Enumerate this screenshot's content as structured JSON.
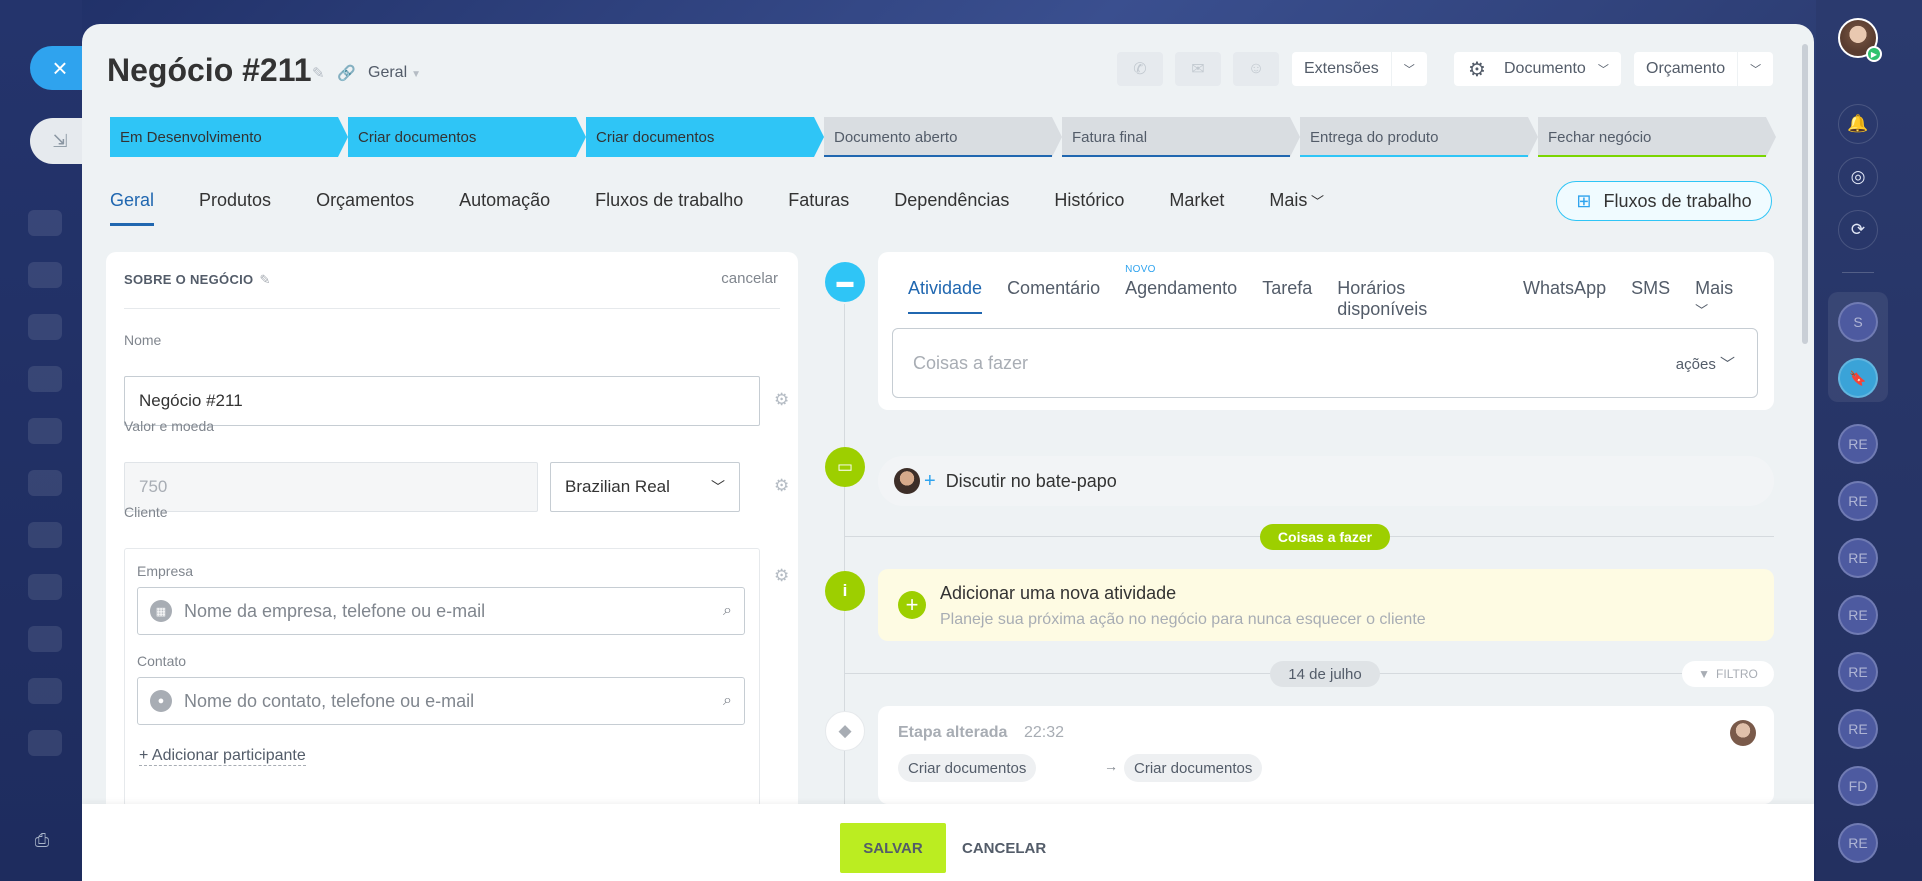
{
  "window": {
    "close_icon": "×",
    "minimize_icon": "⇲"
  },
  "header": {
    "title": "Negócio #211",
    "pipeline": "Geral",
    "extensions": "Extensões",
    "documento": "Documento",
    "orcamento": "Orçamento"
  },
  "stages": [
    {
      "label": "Em Desenvolvimento",
      "state": "done",
      "line": "#2fc5f6"
    },
    {
      "label": "Criar documentos",
      "state": "done",
      "line": "#2fc5f6"
    },
    {
      "label": "Criar documentos",
      "state": "done",
      "line": "#2fc5f6"
    },
    {
      "label": "Documento aberto",
      "state": "todo",
      "line": "#2067b0"
    },
    {
      "label": "Fatura final",
      "state": "todo",
      "line": "#2067b0"
    },
    {
      "label": "Entrega do produto",
      "state": "todo",
      "line": "#2fc5f6"
    },
    {
      "label": "Fechar negócio",
      "state": "todo",
      "line": "#7bd500"
    }
  ],
  "tabs": [
    "Geral",
    "Produtos",
    "Orçamentos",
    "Automação",
    "Fluxos de trabalho",
    "Faturas",
    "Dependências",
    "Histórico",
    "Market",
    "Mais"
  ],
  "workflow_button": "Fluxos de trabalho",
  "about": {
    "title": "SOBRE O NEGÓCIO",
    "cancel": "cancelar",
    "name_label": "Nome",
    "name_value": "Negócio #211",
    "value_label": "Valor e moeda",
    "value": "750",
    "currency": "Brazilian Real",
    "client_label": "Cliente",
    "company_label": "Empresa",
    "company_placeholder": "Nome da empresa, telefone ou e-mail",
    "contact_label": "Contato",
    "contact_placeholder": "Nome do contato, telefone ou e-mail",
    "add_participant": "+ Adicionar participante"
  },
  "activity": {
    "tabs": [
      "Atividade",
      "Comentário",
      "Agendamento",
      "Tarefa",
      "Horários disponíveis",
      "WhatsApp",
      "SMS",
      "Mais"
    ],
    "new_badge": "NOVO",
    "todo_placeholder": "Coisas a fazer",
    "acoes": "ações",
    "chat": "Discutir no bate-papo",
    "todo_badge": "Coisas a fazer",
    "new_title": "Adicionar uma nova atividade",
    "new_sub": "Planeje sua próxima ação no negócio para nunca esquecer o cliente",
    "date": "14 de julho",
    "filter": "FILTRO",
    "stage_changed": "Etapa alterada",
    "stage_time": "22:32",
    "from_stage": "Criar documentos",
    "to_stage": "Criar documentos"
  },
  "footer": {
    "save": "SALVAR",
    "cancel": "CANCELAR"
  },
  "right_bar": {
    "initials": [
      "S",
      "RE",
      "RE",
      "RE",
      "RE",
      "RE",
      "FD",
      "RE"
    ]
  },
  "colors": {
    "accent": "#2fc5f6",
    "link": "#2067b0",
    "green": "#9dcf00",
    "save": "#bbed21"
  }
}
